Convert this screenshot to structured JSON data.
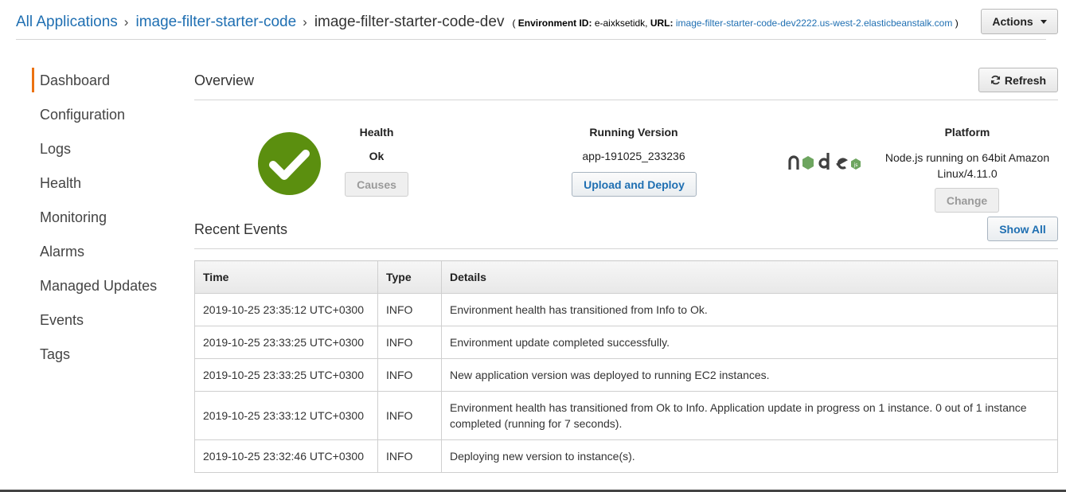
{
  "breadcrumb": {
    "root": "All Applications",
    "app": "image-filter-starter-code",
    "env": "image-filter-starter-code-dev",
    "meta_open": "(",
    "env_id_label": "Environment ID:",
    "env_id": "e-aixksetidk",
    "url_label": "URL:",
    "url": "image-filter-starter-code-dev2222.us-west-2.elasticbeanstalk.com",
    "meta_close": ")"
  },
  "actions_label": "Actions",
  "sidebar": {
    "items": [
      {
        "label": "Dashboard",
        "active": true
      },
      {
        "label": "Configuration"
      },
      {
        "label": "Logs"
      },
      {
        "label": "Health"
      },
      {
        "label": "Monitoring"
      },
      {
        "label": "Alarms"
      },
      {
        "label": "Managed Updates"
      },
      {
        "label": "Events"
      },
      {
        "label": "Tags"
      }
    ]
  },
  "overview": {
    "title": "Overview",
    "refresh_label": "Refresh",
    "health": {
      "label": "Health",
      "value": "Ok",
      "button": "Causes"
    },
    "running_version": {
      "label": "Running Version",
      "value": "app-191025_233236",
      "button": "Upload and Deploy"
    },
    "platform": {
      "label": "Platform",
      "value_line1": "Node.js running on 64bit Amazon",
      "value_line2": "Linux/4.11.0",
      "button": "Change"
    }
  },
  "events": {
    "title": "Recent Events",
    "show_all_label": "Show All",
    "columns": [
      "Time",
      "Type",
      "Details"
    ],
    "rows": [
      {
        "time": "2019-10-25 23:35:12 UTC+0300",
        "type": "INFO",
        "details": "Environment health has transitioned from Info to Ok."
      },
      {
        "time": "2019-10-25 23:33:25 UTC+0300",
        "type": "INFO",
        "details": "Environment update completed successfully."
      },
      {
        "time": "2019-10-25 23:33:25 UTC+0300",
        "type": "INFO",
        "details": "New application version was deployed to running EC2 instances."
      },
      {
        "time": "2019-10-25 23:33:12 UTC+0300",
        "type": "INFO",
        "details": "Environment health has transitioned from Ok to Info. Application update in progress on 1 instance. 0 out of 1 instance completed (running for 7 seconds)."
      },
      {
        "time": "2019-10-25 23:32:46 UTC+0300",
        "type": "INFO",
        "details": "Deploying new version to instance(s)."
      }
    ]
  },
  "colors": {
    "accent": "#ec7211",
    "link": "#1f6fb2",
    "health_ok": "#5b8f0f",
    "info": "#6b8e23"
  },
  "icons": {
    "health": "checkmark-icon",
    "refresh": "refresh-icon",
    "platform": "nodejs-logo"
  }
}
